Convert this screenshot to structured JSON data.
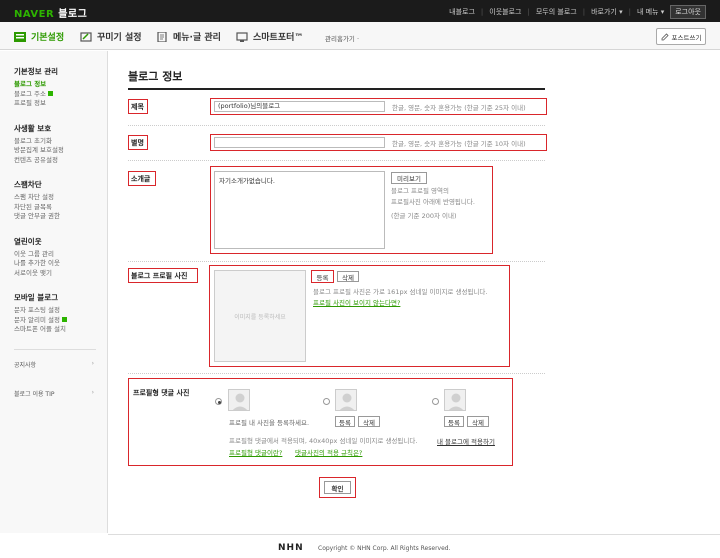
{
  "gnb": {
    "logo_naver": "NAVER",
    "logo_blog": "블로그",
    "links": [
      "내블로그",
      "이웃블로그",
      "모두의 블로그",
      "바로가기 ▾",
      "내 메뉴 ▾"
    ],
    "logout": "로그아웃"
  },
  "menubar": {
    "tabs": [
      "기본설정",
      "꾸미기 설정",
      "메뉴·글 관리",
      "스마트포터™"
    ],
    "sub": "관리홈가기 ·",
    "post_button": "포스트쓰기"
  },
  "sidebar": {
    "groups": [
      {
        "title": "기본정보 관리",
        "items": [
          "블로그 정보",
          "블로그 주소",
          "프로필 정보"
        ]
      },
      {
        "title": "사생활 보호",
        "items": [
          "블로그 초기화",
          "방문집계 보호설정",
          "컨텐츠 공유설정"
        ]
      },
      {
        "title": "스팸차단",
        "items": [
          "스팸 차단 설정",
          "차단된 글목록",
          "댓글 안부글 권한"
        ]
      },
      {
        "title": "열린이웃",
        "items": [
          "이웃 그룹 관리",
          "나를 추가한 이웃",
          "서로이웃 맺기"
        ]
      },
      {
        "title": "모바일 블로그",
        "items": [
          "문자 포스팅 설정",
          "문자 알리미 설정",
          "스마트폰 어플 설치"
        ]
      }
    ],
    "footer": [
      "공지사항",
      "블로그 이용 TIP"
    ]
  },
  "main": {
    "page_title": "블로그 정보",
    "title_label": "제목",
    "title_value": "(portfolio)님의블로그",
    "title_hint": "한글, 영문, 숫자 혼용가능 (한글 기준 25자 이내)",
    "nick_label": "별명",
    "nick_value": "",
    "nick_hint": "한글, 영문, 숫자 혼용가능 (한글 기준 10자 이내)",
    "intro_label": "소개글",
    "intro_value": "자기소개가없습니다.",
    "preview_button": "미리보기",
    "intro_hint1": "블로그 프로필 영역의",
    "intro_hint2": "프로필사진 아래에 반영됩니다.",
    "intro_hint3": "(한글 기준 200자 이내)",
    "photo_label": "블로그 프로필 사진",
    "photo_placeholder": "이미지를 등록하세요",
    "register_button": "등록",
    "delete_button": "삭제",
    "photo_hint": "블로그 프로필 사진은 가로 161px 섬네일 이미지로 생성됩니다.",
    "photo_link": "프로필 사진이 보이지 않는다면?",
    "comment_label": "프로필형 댓글 사진",
    "comment_register_text": "프로필 내 사진을 등록하세요.",
    "comment_hint": "프로필형 댓글에서 적용되며, 40x40px 섬네일 이미지로 생성됩니다.",
    "comment_hint_link": "내 블로그에 적용하기",
    "comment_link1": "프로필형 댓글이란?",
    "comment_link2": "댓글사진의 적용 규칙은?",
    "confirm_button": "확인"
  },
  "footer": {
    "logo": "NHN",
    "copyright": "Copyright © NHN Corp. All Rights Reserved."
  }
}
